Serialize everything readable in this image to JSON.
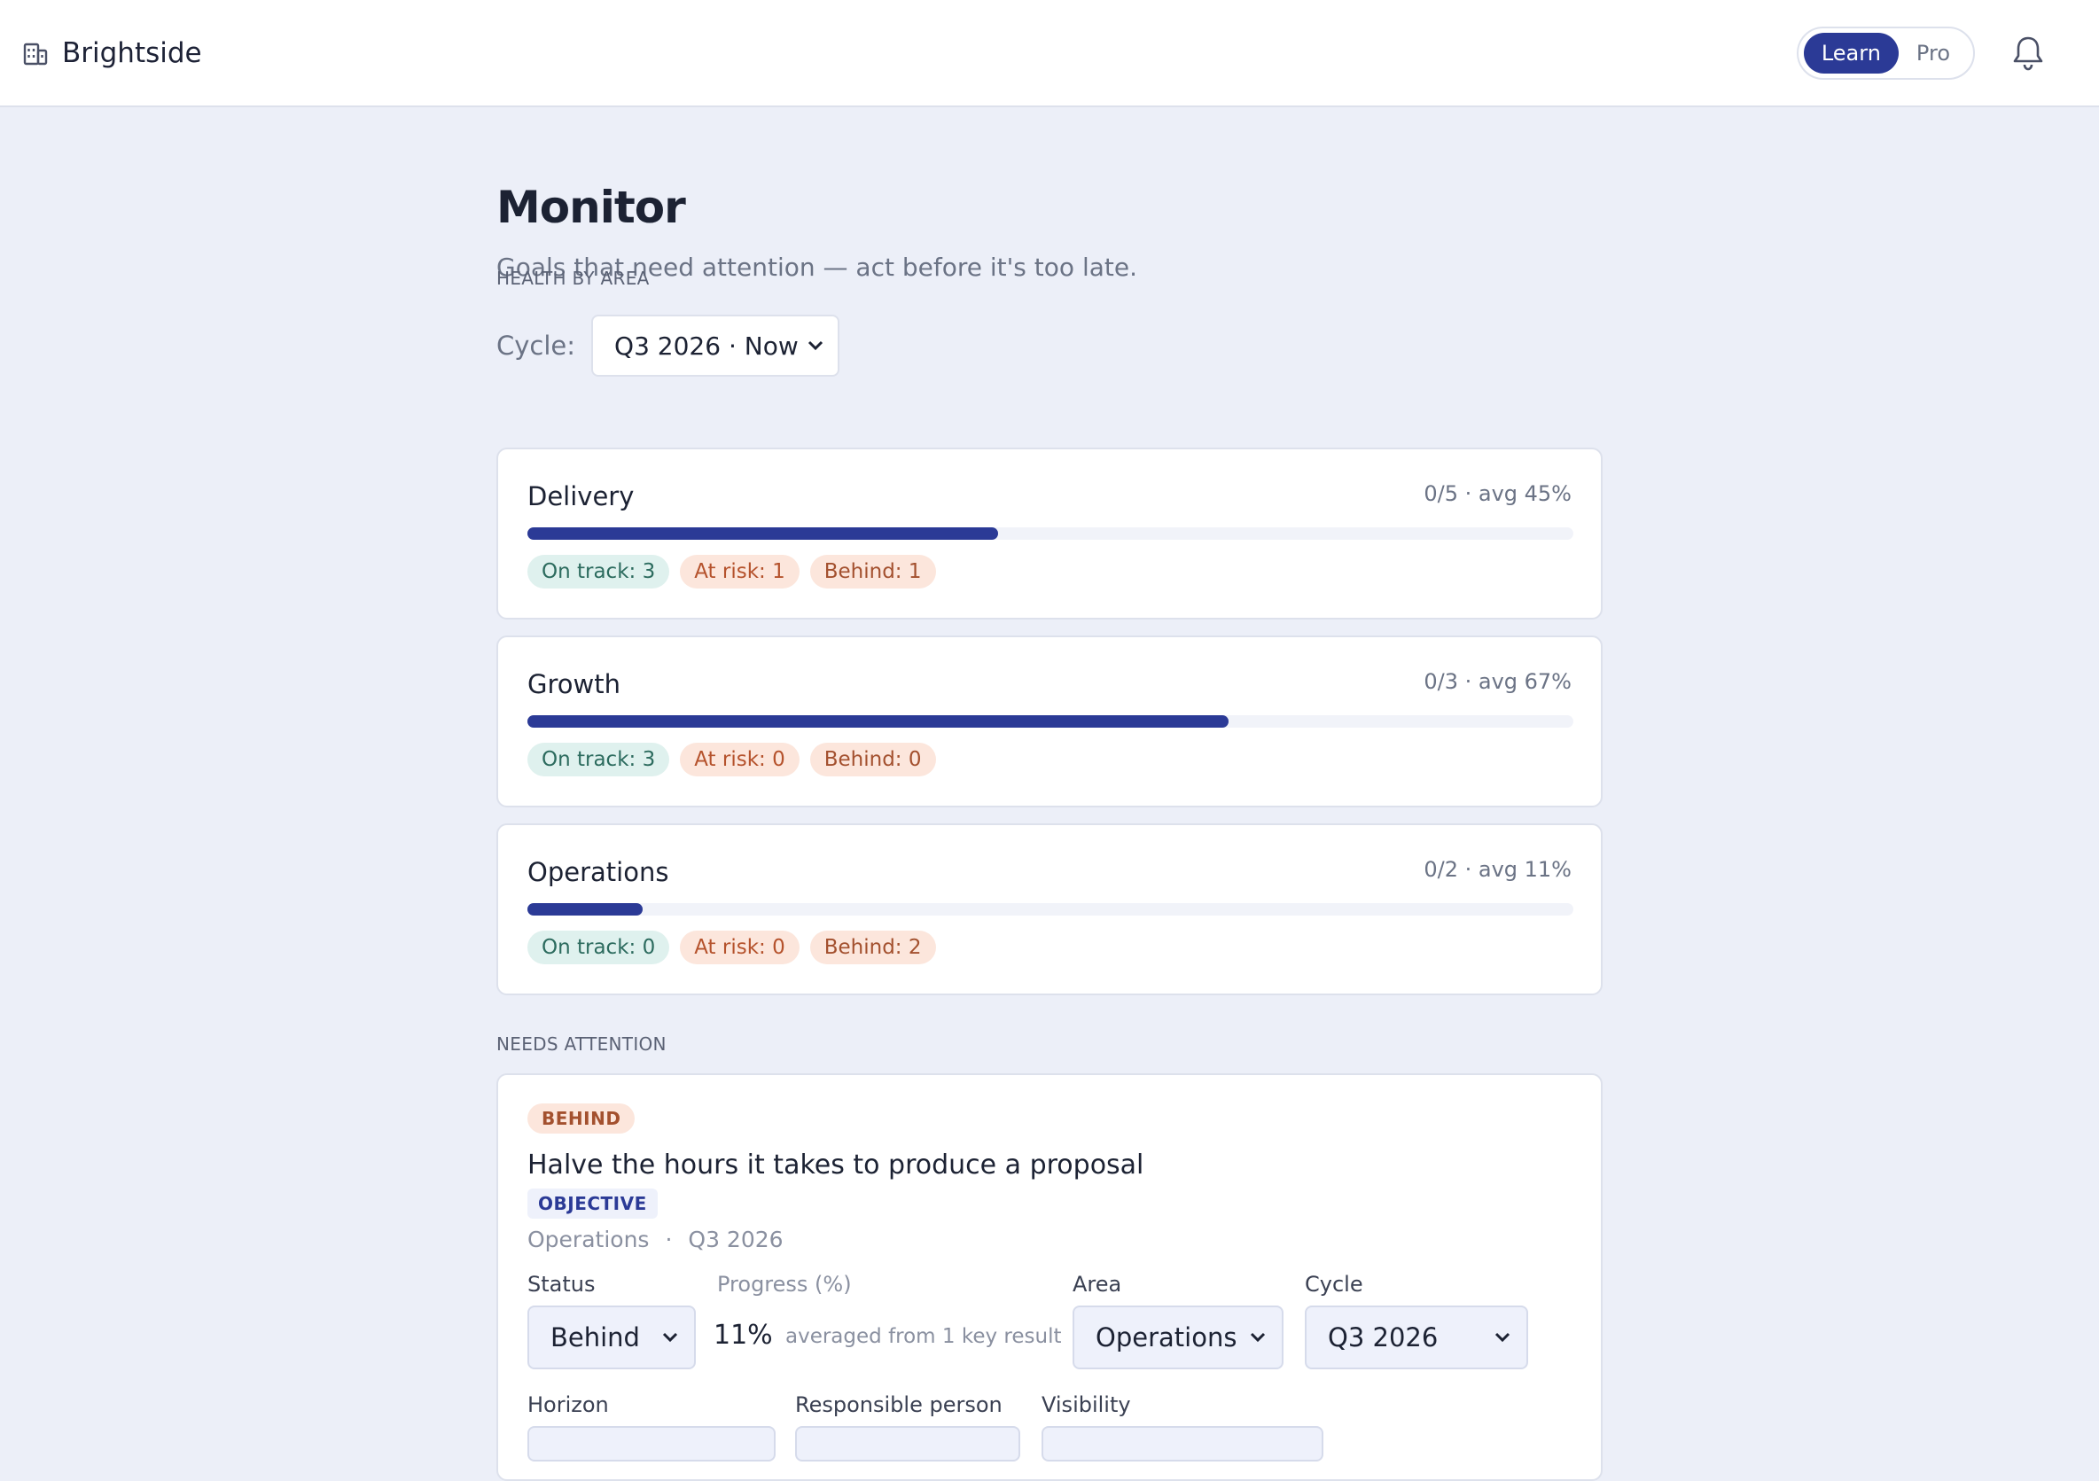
{
  "app": {
    "brand": "Brightside"
  },
  "header": {
    "modes": [
      {
        "label": "Learn",
        "active": true
      },
      {
        "label": "Pro",
        "active": false
      }
    ]
  },
  "page": {
    "title": "Monitor",
    "subtitle": "Goals that need attention — act before it's too late.",
    "cycle_label": "Cycle:",
    "cycle_value": "Q3 2026 · Now"
  },
  "health": {
    "section_label": "HEALTH BY AREA",
    "areas": [
      {
        "name": "Delivery",
        "stats": "0/5 · avg 45%",
        "avg_fraction": 0.45,
        "on_track": "On track: 3",
        "at_risk": "At risk: 1",
        "behind": "Behind: 1"
      },
      {
        "name": "Growth",
        "stats": "0/3 · avg 67%",
        "avg_fraction": 0.67,
        "on_track": "On track: 3",
        "at_risk": "At risk: 0",
        "behind": "Behind: 0"
      },
      {
        "name": "Operations",
        "stats": "0/2 · avg 11%",
        "avg_fraction": 0.11,
        "on_track": "On track: 0",
        "at_risk": "At risk: 0",
        "behind": "Behind: 2"
      }
    ]
  },
  "attention": {
    "section_label": "NEEDS ATTENTION",
    "goal": {
      "badge": "BEHIND",
      "title": "Halve the hours it takes to produce a proposal",
      "type": "OBJECTIVE",
      "area": "Operations",
      "separator": "·",
      "cycle": "Q3 2026",
      "status_label": "Status",
      "status_value": "Behind",
      "progress_label": "Progress (%)",
      "progress_value": "11%",
      "progress_note": "averaged from 1 key result",
      "area_label": "Area",
      "area_value": "Operations",
      "cycle_label": "Cycle",
      "cycle_value": "Q3 2026",
      "horizon_label": "Horizon",
      "responsible_label": "Responsible person",
      "visibility_label": "Visibility"
    }
  },
  "colors": {
    "accent": "#2b3a96",
    "on_track_bg": "#dff1ee",
    "risk_bg": "#fce6dc",
    "page_bg": "#eceff8"
  }
}
